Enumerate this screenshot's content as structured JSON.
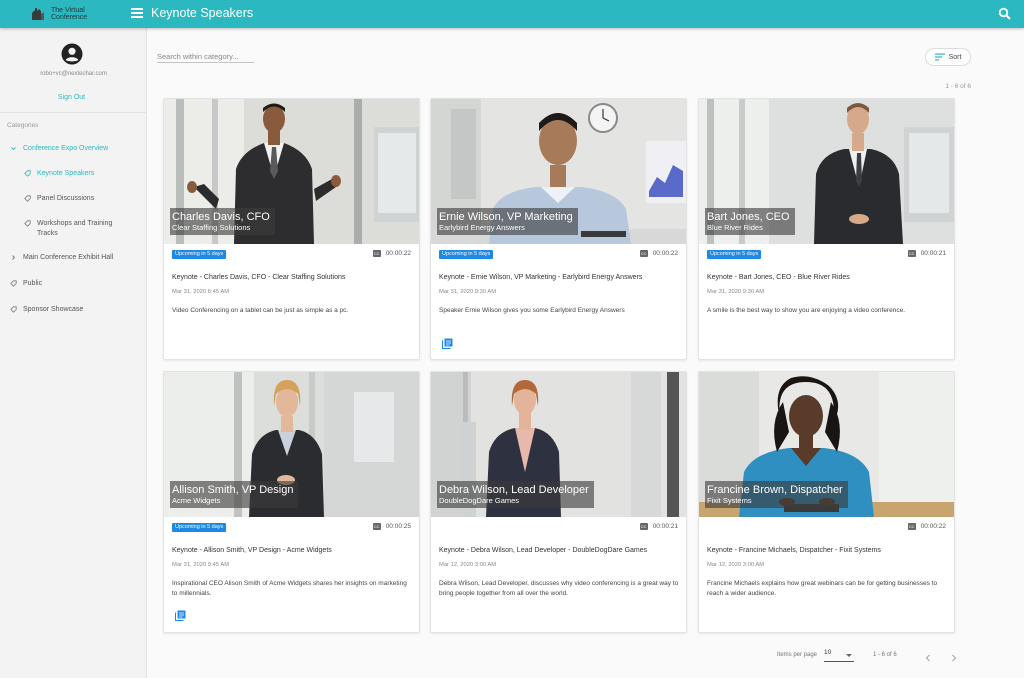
{
  "app": {
    "logo_line1": "The Virtual",
    "logo_line2": "Conference"
  },
  "header": {
    "title": "Keynote Speakers"
  },
  "sidebar": {
    "email": "robo+vc@nextechar.com",
    "sign_out": "Sign Out",
    "categories_label": "Categories",
    "items": [
      {
        "label": "Conference Expo Overview"
      },
      {
        "label": "Keynote Speakers"
      },
      {
        "label": "Panel Discussions"
      },
      {
        "label": "Workshops and Training Tracks"
      },
      {
        "label": "Main Conference Exhibit Hall"
      },
      {
        "label": "Public"
      },
      {
        "label": "Sponsor Showcase"
      }
    ]
  },
  "search": {
    "placeholder": "Search within category..."
  },
  "sort": {
    "label": "Sort"
  },
  "range_top": "1 - 6 of 6",
  "cards": [
    {
      "name": "Charles Davis, CFO",
      "company": "Clear Staffing Solutions",
      "badge": "Upcoming in 5 days",
      "duration": "00:00:22",
      "title": "Keynote - Charles Davis, CFO - Clear Staffing Solutions",
      "date": "Mar 31, 2020 6:45 AM",
      "desc": "Video Conferencing on a tablet can be just as simple as a pc."
    },
    {
      "name": "Ernie Wilson, VP Marketing",
      "company": "Earlybird Energy Answers",
      "badge": "Upcoming in 5 days",
      "duration": "00:00:22",
      "title": "Keynote - Ernie Wilson, VP Marketing - Earlybird Energy Answers",
      "date": "Mar 31, 2020 9:30 AM",
      "desc": "Speaker Ernie Wilson gives you some Earlybird Energy Answers"
    },
    {
      "name": "Bart Jones, CEO",
      "company": "Blue River Rides",
      "badge": "Upcoming in 5 days",
      "duration": "00:00:21",
      "title": "Keynote - Bart Jones, CEO - Blue River Rides",
      "date": "Mar 31, 2020 9:30 AM",
      "desc": "A smile is the best way to show you are enjoying a video conference."
    },
    {
      "name": "Allison Smith, VP Design",
      "company": "Acme Widgets",
      "badge": "Upcoming in 5 days",
      "duration": "00:00:25",
      "title": "Keynote - Allison Smith, VP Design - Acme Widgets",
      "date": "Mar 31, 2020 9:45 AM",
      "desc": "Inspirational CEO Alison Smith of Acme Widgets shares her insights on marketing to millennials."
    },
    {
      "name": "Debra Wilson, Lead Developer",
      "company": "DoubleDogDare Games",
      "badge": "",
      "duration": "00:00:21",
      "title": "Keynote - Debra Wilson, Lead Developer - DoubleDogDare Games",
      "date": "Mar 12, 2020 3:00 AM",
      "desc": "Debra Wilson, Lead Developer, discusses why video conferencing is a great way to bring people together from all over the world."
    },
    {
      "name": "Francine Brown, Dispatcher",
      "company": "Fixit Systems",
      "badge": "",
      "duration": "00:00:22",
      "title": "Keynote - Francine Michaels, Dispatcher - Fixit Systems",
      "date": "Mar 12, 2020 3:00 AM",
      "desc": "Francine Michaels explains how great webinars can be for getting businesses to reach a wider audience."
    }
  ],
  "pagination": {
    "items_per_page_label": "Items per page",
    "per_page_value": "10",
    "range": "1 - 6 of 6"
  },
  "colors": {
    "accent": "#2bb8c0",
    "badge": "#1e88e5"
  }
}
